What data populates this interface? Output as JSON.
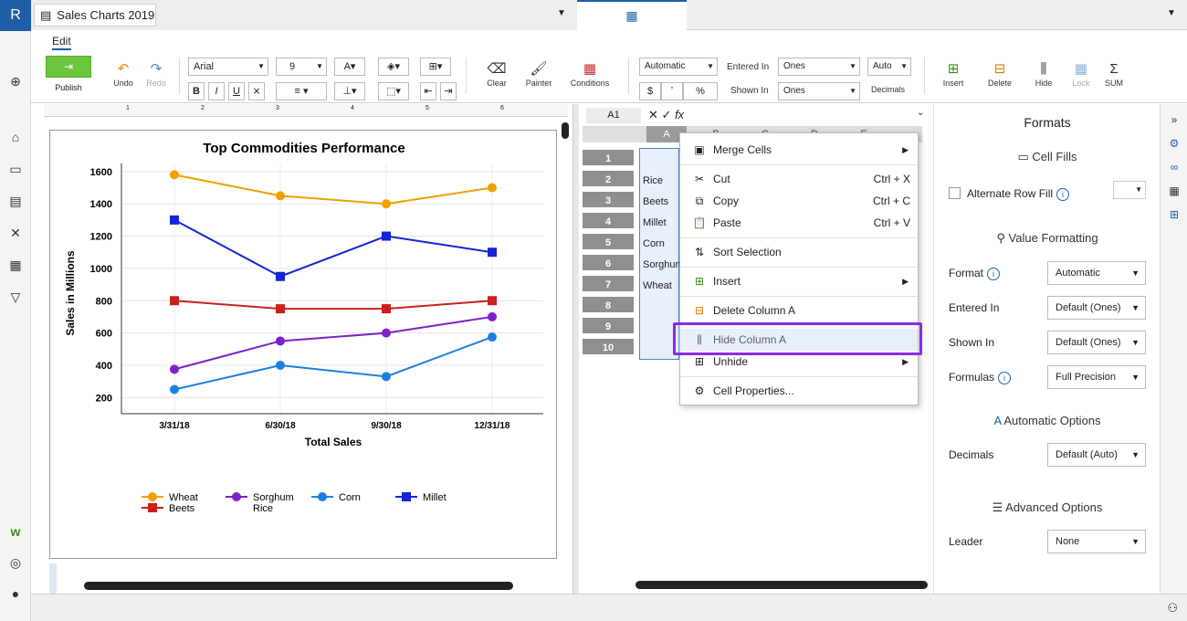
{
  "app": {
    "logo": "R",
    "doc_tab_title": "Sales Charts 2019"
  },
  "ribbon": {
    "edit_tab": "Edit",
    "publish": "Publish",
    "undo": "Undo",
    "redo": "Redo",
    "font_name": "Arial",
    "font_size": "9",
    "clear": "Clear",
    "painter": "Painter",
    "conditions": "Conditions",
    "number_format": "Automatic",
    "currency": "$",
    "comma": "ʼ",
    "percent": "%",
    "entered_in_label": "Entered In",
    "entered_in_value": "Ones",
    "shown_in_label": "Shown In",
    "shown_in_value": "Ones",
    "decimals_value": "Auto",
    "decimals_label": "Decimals",
    "insert": "Insert",
    "delete": "Delete",
    "hide": "Hide",
    "lock": "Lock",
    "sum_symbol": "Σ",
    "sum": "SUM"
  },
  "ruler_ticks": [
    "1",
    "2",
    "3",
    "4",
    "5",
    "6"
  ],
  "chart_data": {
    "type": "line",
    "title": "Top Commodities Performance",
    "xlabel": "Total Sales",
    "ylabel": "Sales in Millions",
    "categories": [
      "3/31/18",
      "6/30/18",
      "9/30/18",
      "12/31/18"
    ],
    "ylim": [
      100,
      1650
    ],
    "yticks": [
      "1600",
      "1400",
      "1200",
      "1000",
      "800",
      "600",
      "400",
      "200"
    ],
    "series": [
      {
        "name": "Wheat",
        "color": "#f0a000",
        "marker": "circle",
        "values": [
          1580,
          1450,
          1400,
          1500
        ]
      },
      {
        "name": "Beets",
        "color": "#cc1f1f",
        "marker": "square",
        "values": [
          800,
          750,
          750,
          800
        ]
      },
      {
        "name": "Sorghum",
        "color": "#7b22c8",
        "marker": "circle",
        "values": [
          375,
          550,
          600,
          700
        ]
      },
      {
        "name": "Rice",
        "color": "#7b22c8",
        "marker": "circle",
        "values": [
          375,
          550,
          600,
          700
        ]
      },
      {
        "name": "Corn",
        "color": "#1e7fe0",
        "marker": "circle",
        "values": [
          250,
          400,
          330,
          575
        ]
      },
      {
        "name": "Millet",
        "color": "#1424d6",
        "marker": "square",
        "values": [
          1300,
          950,
          1200,
          1100
        ]
      }
    ],
    "legend": "bottom"
  },
  "sheet": {
    "cell_ref": "A1",
    "columns": [
      "A",
      "B",
      "C",
      "D",
      "E"
    ],
    "rows": [
      "1",
      "2",
      "3",
      "4",
      "5",
      "6",
      "7",
      "8",
      "9",
      "10"
    ],
    "col_a_values": [
      "",
      "Rice",
      "Beets",
      "Millet",
      "Corn",
      "Sorghum",
      "Wheat",
      "",
      "",
      ""
    ]
  },
  "context_menu": {
    "merge_cells": "Merge Cells",
    "cut": "Cut",
    "cut_sc": "Ctrl + X",
    "copy": "Copy",
    "copy_sc": "Ctrl + C",
    "paste": "Paste",
    "paste_sc": "Ctrl + V",
    "sort_selection": "Sort Selection",
    "insert": "Insert",
    "delete_column": "Delete Column A",
    "hide_column": "Hide Column A",
    "unhide": "Unhide",
    "cell_properties": "Cell Properties..."
  },
  "formats": {
    "title": "Formats",
    "cell_fills": "Cell Fills",
    "alternate_row_fill": "Alternate Row Fill",
    "value_formatting": "Value Formatting",
    "format_label": "Format",
    "format_value": "Automatic",
    "entered_in_label": "Entered In",
    "entered_in_value": "Default (Ones)",
    "shown_in_label": "Shown In",
    "shown_in_value": "Default (Ones)",
    "formulas_label": "Formulas",
    "formulas_value": "Full Precision",
    "automatic_options": "Automatic Options",
    "decimals_label": "Decimals",
    "decimals_value": "Default (Auto)",
    "advanced_options": "Advanced Options",
    "leader_label": "Leader",
    "leader_value": "None"
  },
  "colors": {
    "brand": "#1f5fa8",
    "publish": "#6bc53d",
    "highlight": "#8a2be2"
  }
}
